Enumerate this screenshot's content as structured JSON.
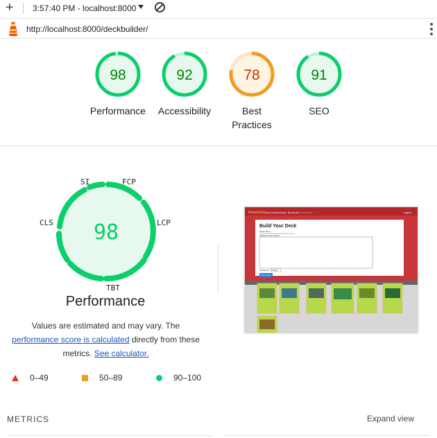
{
  "topbar": {
    "plus": "+",
    "timestamp": "3:57:40 PM - localhost:8000"
  },
  "urlbar": {
    "url": "http://localhost:8000/deckbuilder/"
  },
  "scores": [
    {
      "label": "Performance",
      "value": "98",
      "color": "#0cce6b",
      "text_color": "#008800",
      "bg": "#e7f8ee"
    },
    {
      "label": "Accessibility",
      "value": "92",
      "color": "#0cce6b",
      "text_color": "#008800",
      "bg": "#e7f8ee"
    },
    {
      "label": "Best Practices",
      "value": "78",
      "color": "#f29c1f",
      "text_color": "#c33300",
      "bg": "#fff3e2"
    },
    {
      "label": "SEO",
      "value": "91",
      "color": "#0cce6b",
      "text_color": "#008800",
      "bg": "#e7f8ee"
    }
  ],
  "performance": {
    "score": "98",
    "title": "Performance",
    "axis": {
      "si": "SI",
      "fcp": "FCP",
      "cls": "CLS",
      "lcp": "LCP",
      "tbt": "TBT"
    }
  },
  "description": {
    "line1": "Values are estimated and may vary. The",
    "link1": "performance score is calculated",
    "middle": " directly from these",
    "metrics_prefix": "metrics. ",
    "link2": "See calculator."
  },
  "legend": {
    "fail": "0–49",
    "average": "50–89",
    "pass": "90–100"
  },
  "screenshot": {
    "brand": "PokeDecks",
    "nav": [
      "Card Library",
      "Decks",
      "My Decks",
      "Deck Builder"
    ],
    "login": "Logout",
    "heading": "Build Your Deck",
    "deck_name_label": "Deck Name:",
    "info_label": "Additional Information:",
    "visibility_label": "Published:",
    "visibility_value": "Private",
    "save_button": "Save Deck"
  },
  "metrics": {
    "label": "METRICS",
    "expand": "Expand view"
  }
}
